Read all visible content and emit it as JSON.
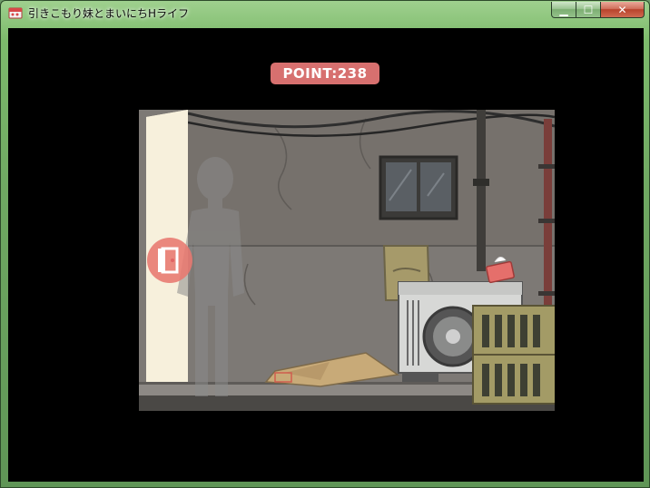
{
  "window": {
    "title": "引きこもり妹とまいにちHライフ",
    "controls": {
      "minimize": "▁",
      "maximize": "☐",
      "close": "✕"
    }
  },
  "hud": {
    "point_label": "POINT:238"
  },
  "scene": {
    "location": "rooftop",
    "character": "silhouette",
    "accent_color": "#d7706f",
    "icons": [
      "door-icon",
      "tissue-box-icon",
      "air-conditioner-unit",
      "bottle-crate"
    ]
  }
}
